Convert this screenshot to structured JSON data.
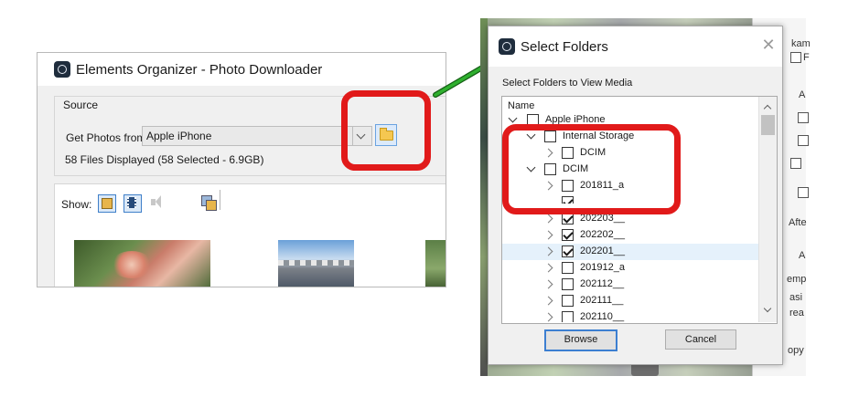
{
  "photo_downloader": {
    "title": "Elements Organizer - Photo Downloader",
    "source_label": "Source",
    "get_photos_label": "Get Photos from:",
    "device_selected": "Apple iPhone",
    "files_info": "58 Files Displayed (58 Selected - 6.9GB)",
    "show_label": "Show:"
  },
  "select_folders": {
    "title": "Select Folders",
    "instruction": "Select Folders to View Media",
    "column_header": "Name",
    "tree": [
      {
        "label": "Apple iPhone",
        "checked": false,
        "expanded": true
      },
      {
        "label": "Internal Storage",
        "checked": false,
        "expanded": true
      },
      {
        "label": "DCIM",
        "checked": false,
        "expanded": false
      },
      {
        "label": "DCIM",
        "checked": false,
        "expanded": true
      },
      {
        "label": "201811_a",
        "checked": false,
        "expanded": false
      },
      {
        "label": "",
        "checked": true,
        "expanded": false
      },
      {
        "label": "202203__",
        "checked": true,
        "expanded": false
      },
      {
        "label": "202202__",
        "checked": true,
        "expanded": false
      },
      {
        "label": "202201__",
        "checked": true,
        "expanded": false,
        "selected": true
      },
      {
        "label": "201912_a",
        "checked": false,
        "expanded": false
      },
      {
        "label": "202112__",
        "checked": false,
        "expanded": false
      },
      {
        "label": "202111__",
        "checked": false,
        "expanded": false
      },
      {
        "label": "202110__",
        "checked": false,
        "expanded": false
      }
    ],
    "browse_label": "Browse",
    "cancel_label": "Cancel"
  },
  "background_panel": {
    "fragments": [
      "kam",
      "F",
      "A",
      "Afte",
      "A",
      "emp",
      "asi",
      "rea",
      "opy"
    ]
  },
  "colors": {
    "highlight": "#e11a1a",
    "arrow": "#2fb02f",
    "focus": "#3c7fd1"
  }
}
